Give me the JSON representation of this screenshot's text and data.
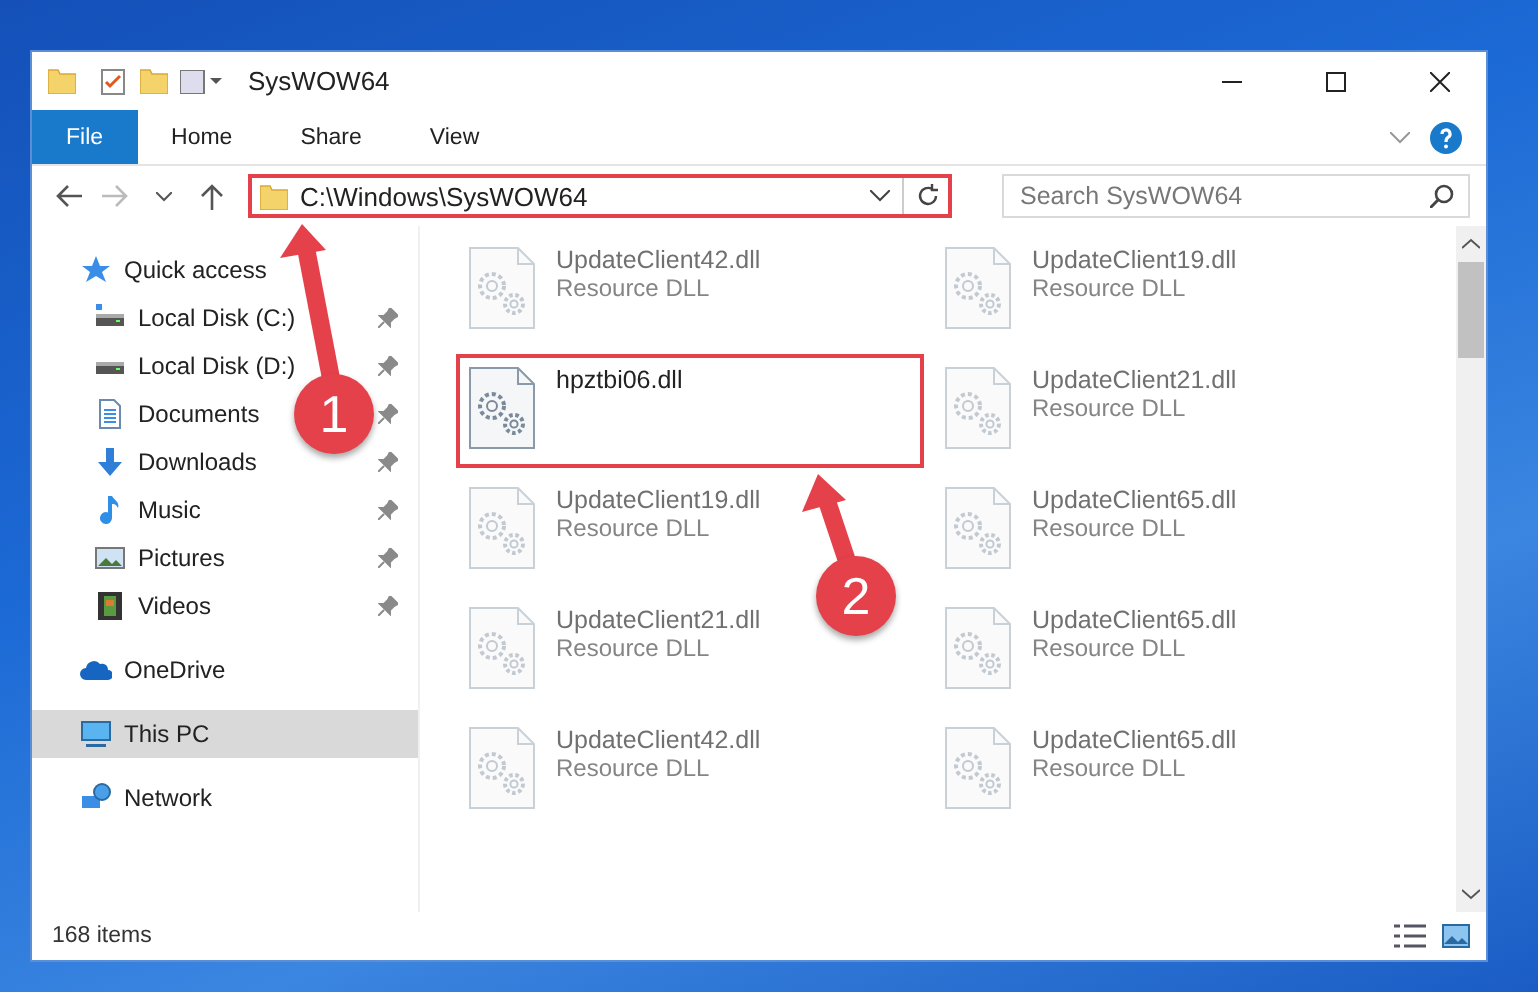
{
  "window": {
    "title": "SysWOW64"
  },
  "ribbon": {
    "tabs": [
      {
        "label": "File",
        "selected": true
      },
      {
        "label": "Home",
        "selected": false
      },
      {
        "label": "Share",
        "selected": false
      },
      {
        "label": "View",
        "selected": false
      }
    ]
  },
  "address": {
    "path": "C:\\Windows\\SysWOW64",
    "highlighted": true
  },
  "search": {
    "placeholder": "Search SysWOW64"
  },
  "sidebar": {
    "items": [
      {
        "label": "Quick access",
        "selected": false,
        "children": [
          {
            "label": "Local Disk (C:)",
            "pinned": true,
            "selected": false
          },
          {
            "label": "Local Disk (D:)",
            "pinned": true,
            "selected": false
          },
          {
            "label": "Documents",
            "pinned": true,
            "selected": false
          },
          {
            "label": "Downloads",
            "pinned": true,
            "selected": false
          },
          {
            "label": "Music",
            "pinned": true,
            "selected": false
          },
          {
            "label": "Pictures",
            "pinned": true,
            "selected": false
          },
          {
            "label": "Videos",
            "pinned": true,
            "selected": false
          }
        ]
      },
      {
        "label": "OneDrive",
        "selected": false
      },
      {
        "label": "This PC",
        "selected": true
      },
      {
        "label": "Network",
        "selected": false
      }
    ]
  },
  "files": [
    {
      "name": "UpdateClient42.dll",
      "type": "Resource DLL",
      "blurred": true,
      "highlighted": false
    },
    {
      "name": "UpdateClient19.dll",
      "type": "Resource DLL",
      "blurred": true,
      "highlighted": false
    },
    {
      "name": "hpztbi06.dll",
      "blurred": false,
      "highlighted": true
    },
    {
      "name": "UpdateClient21.dll",
      "type": "Resource DLL",
      "blurred": true,
      "highlighted": false
    },
    {
      "name": "UpdateClient19.dll",
      "type": "Resource DLL",
      "blurred": true,
      "highlighted": false
    },
    {
      "name": "UpdateClient65.dll",
      "type": "Resource DLL",
      "blurred": true,
      "highlighted": false
    },
    {
      "name": "UpdateClient21.dll",
      "type": "Resource DLL",
      "blurred": true,
      "highlighted": false
    },
    {
      "name": "UpdateClient65.dll",
      "type": "Resource DLL",
      "blurred": true,
      "highlighted": false
    },
    {
      "name": "UpdateClient42.dll",
      "type": "Resource DLL",
      "blurred": true,
      "highlighted": false
    },
    {
      "name": "UpdateClient65.dll",
      "type": "Resource DLL",
      "blurred": true,
      "highlighted": false
    }
  ],
  "callouts": [
    {
      "label": "1"
    },
    {
      "label": "2"
    }
  ],
  "status_bar": {
    "count": "168 items"
  }
}
